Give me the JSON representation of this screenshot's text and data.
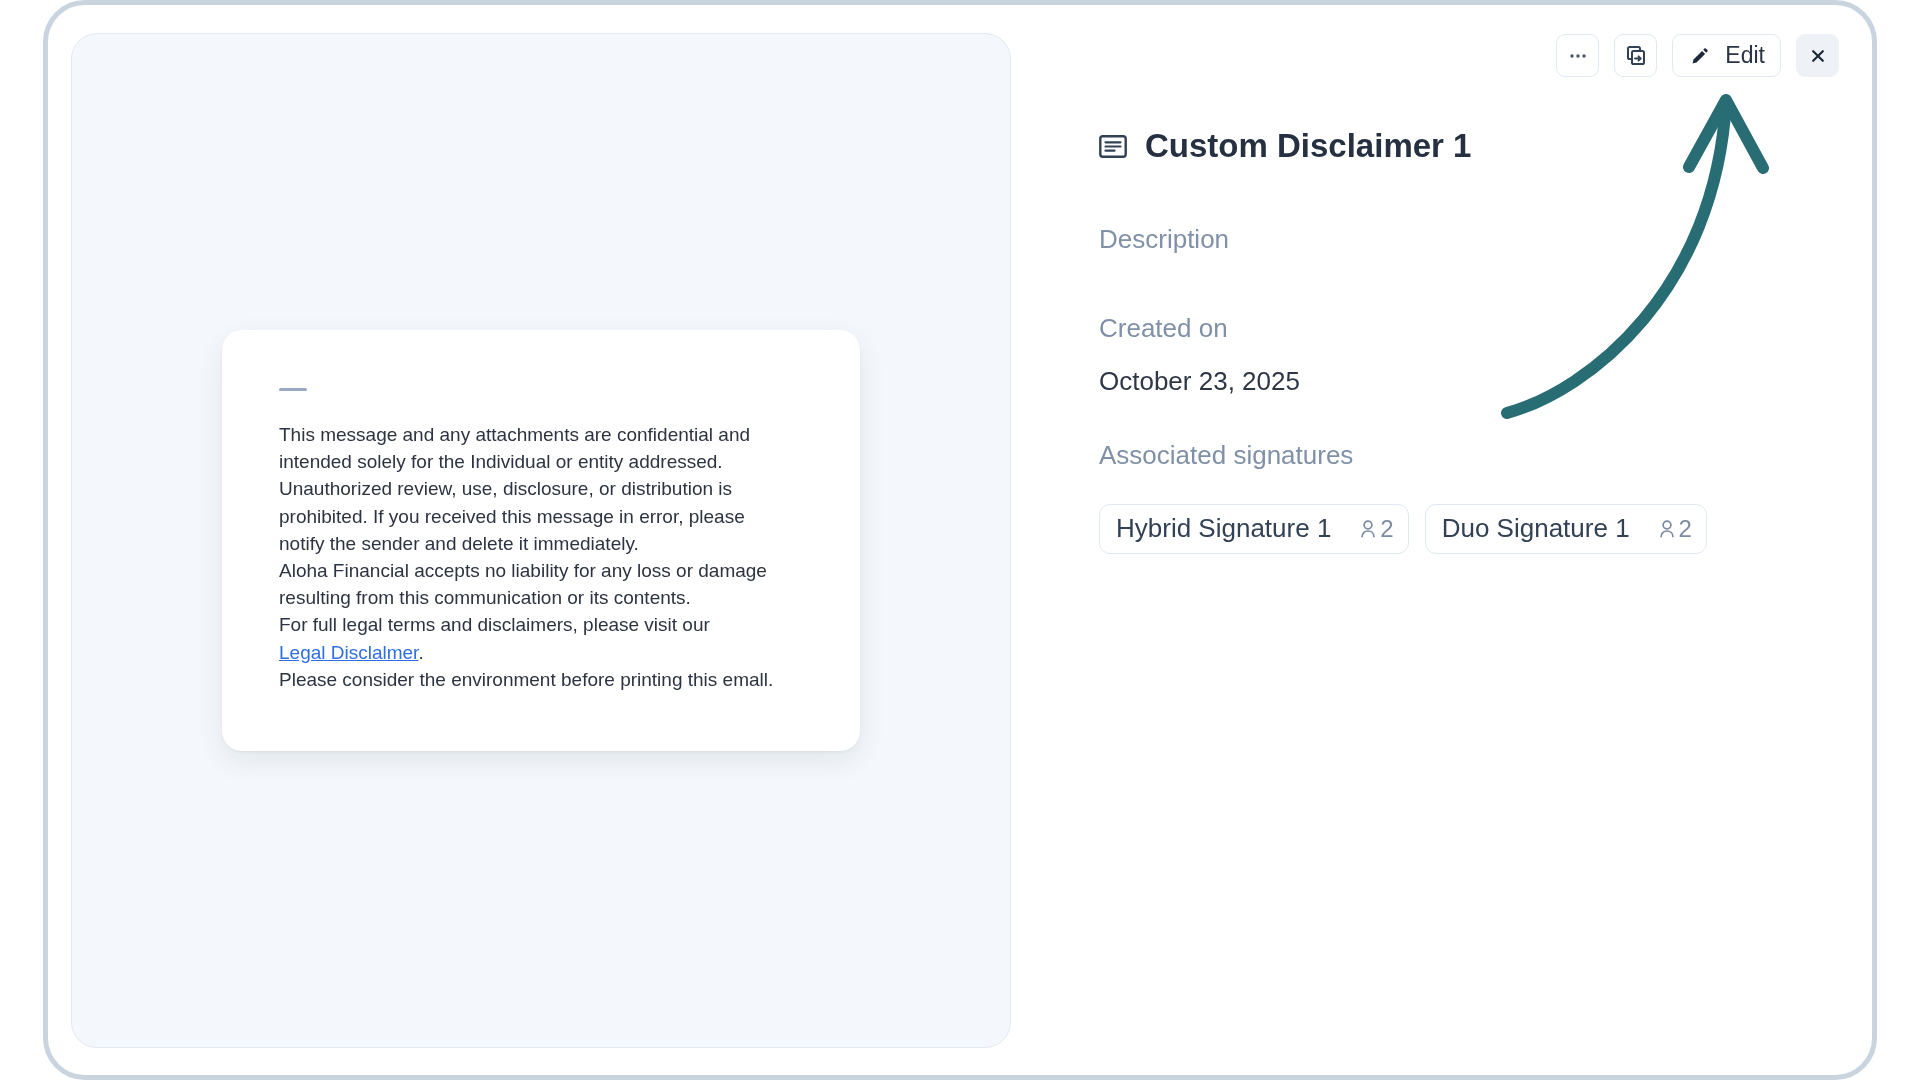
{
  "toolbar": [
    {
      "kind": "more"
    },
    {
      "kind": "duplicate"
    },
    {
      "kind": "edit",
      "label": "Edit"
    },
    {
      "kind": "close"
    }
  ],
  "preview": {
    "paragraphs": [
      {
        "text": "This message and any attachments are confidential and intended solely for the Individual or entity addressed. Unauthorized review, use, disclosure, or distribution is prohibited. If you received this message in error, please notify the sender and delete it immediately."
      },
      {
        "text": "Aloha Financial accepts no liability for any loss or damage resulting from this communication or its contents."
      },
      {
        "text": "For full legal terms and disclaimers, please visit our ",
        "link": "Legal Disclalmer",
        "text_after": "."
      },
      {
        "text": "Please consider the environment before printing this emall."
      }
    ]
  },
  "details": {
    "title": "Custom Disclaimer 1",
    "description": {
      "label": "Description"
    },
    "created_on": {
      "label": "Created on",
      "value": "October 23, 2025"
    },
    "associated_signatures": {
      "label": "Associated signatures",
      "items": [
        {
          "name": "Hybrid Signature 1",
          "count": "2"
        },
        {
          "name": "Duo Signature 1",
          "count": "2"
        }
      ]
    }
  }
}
